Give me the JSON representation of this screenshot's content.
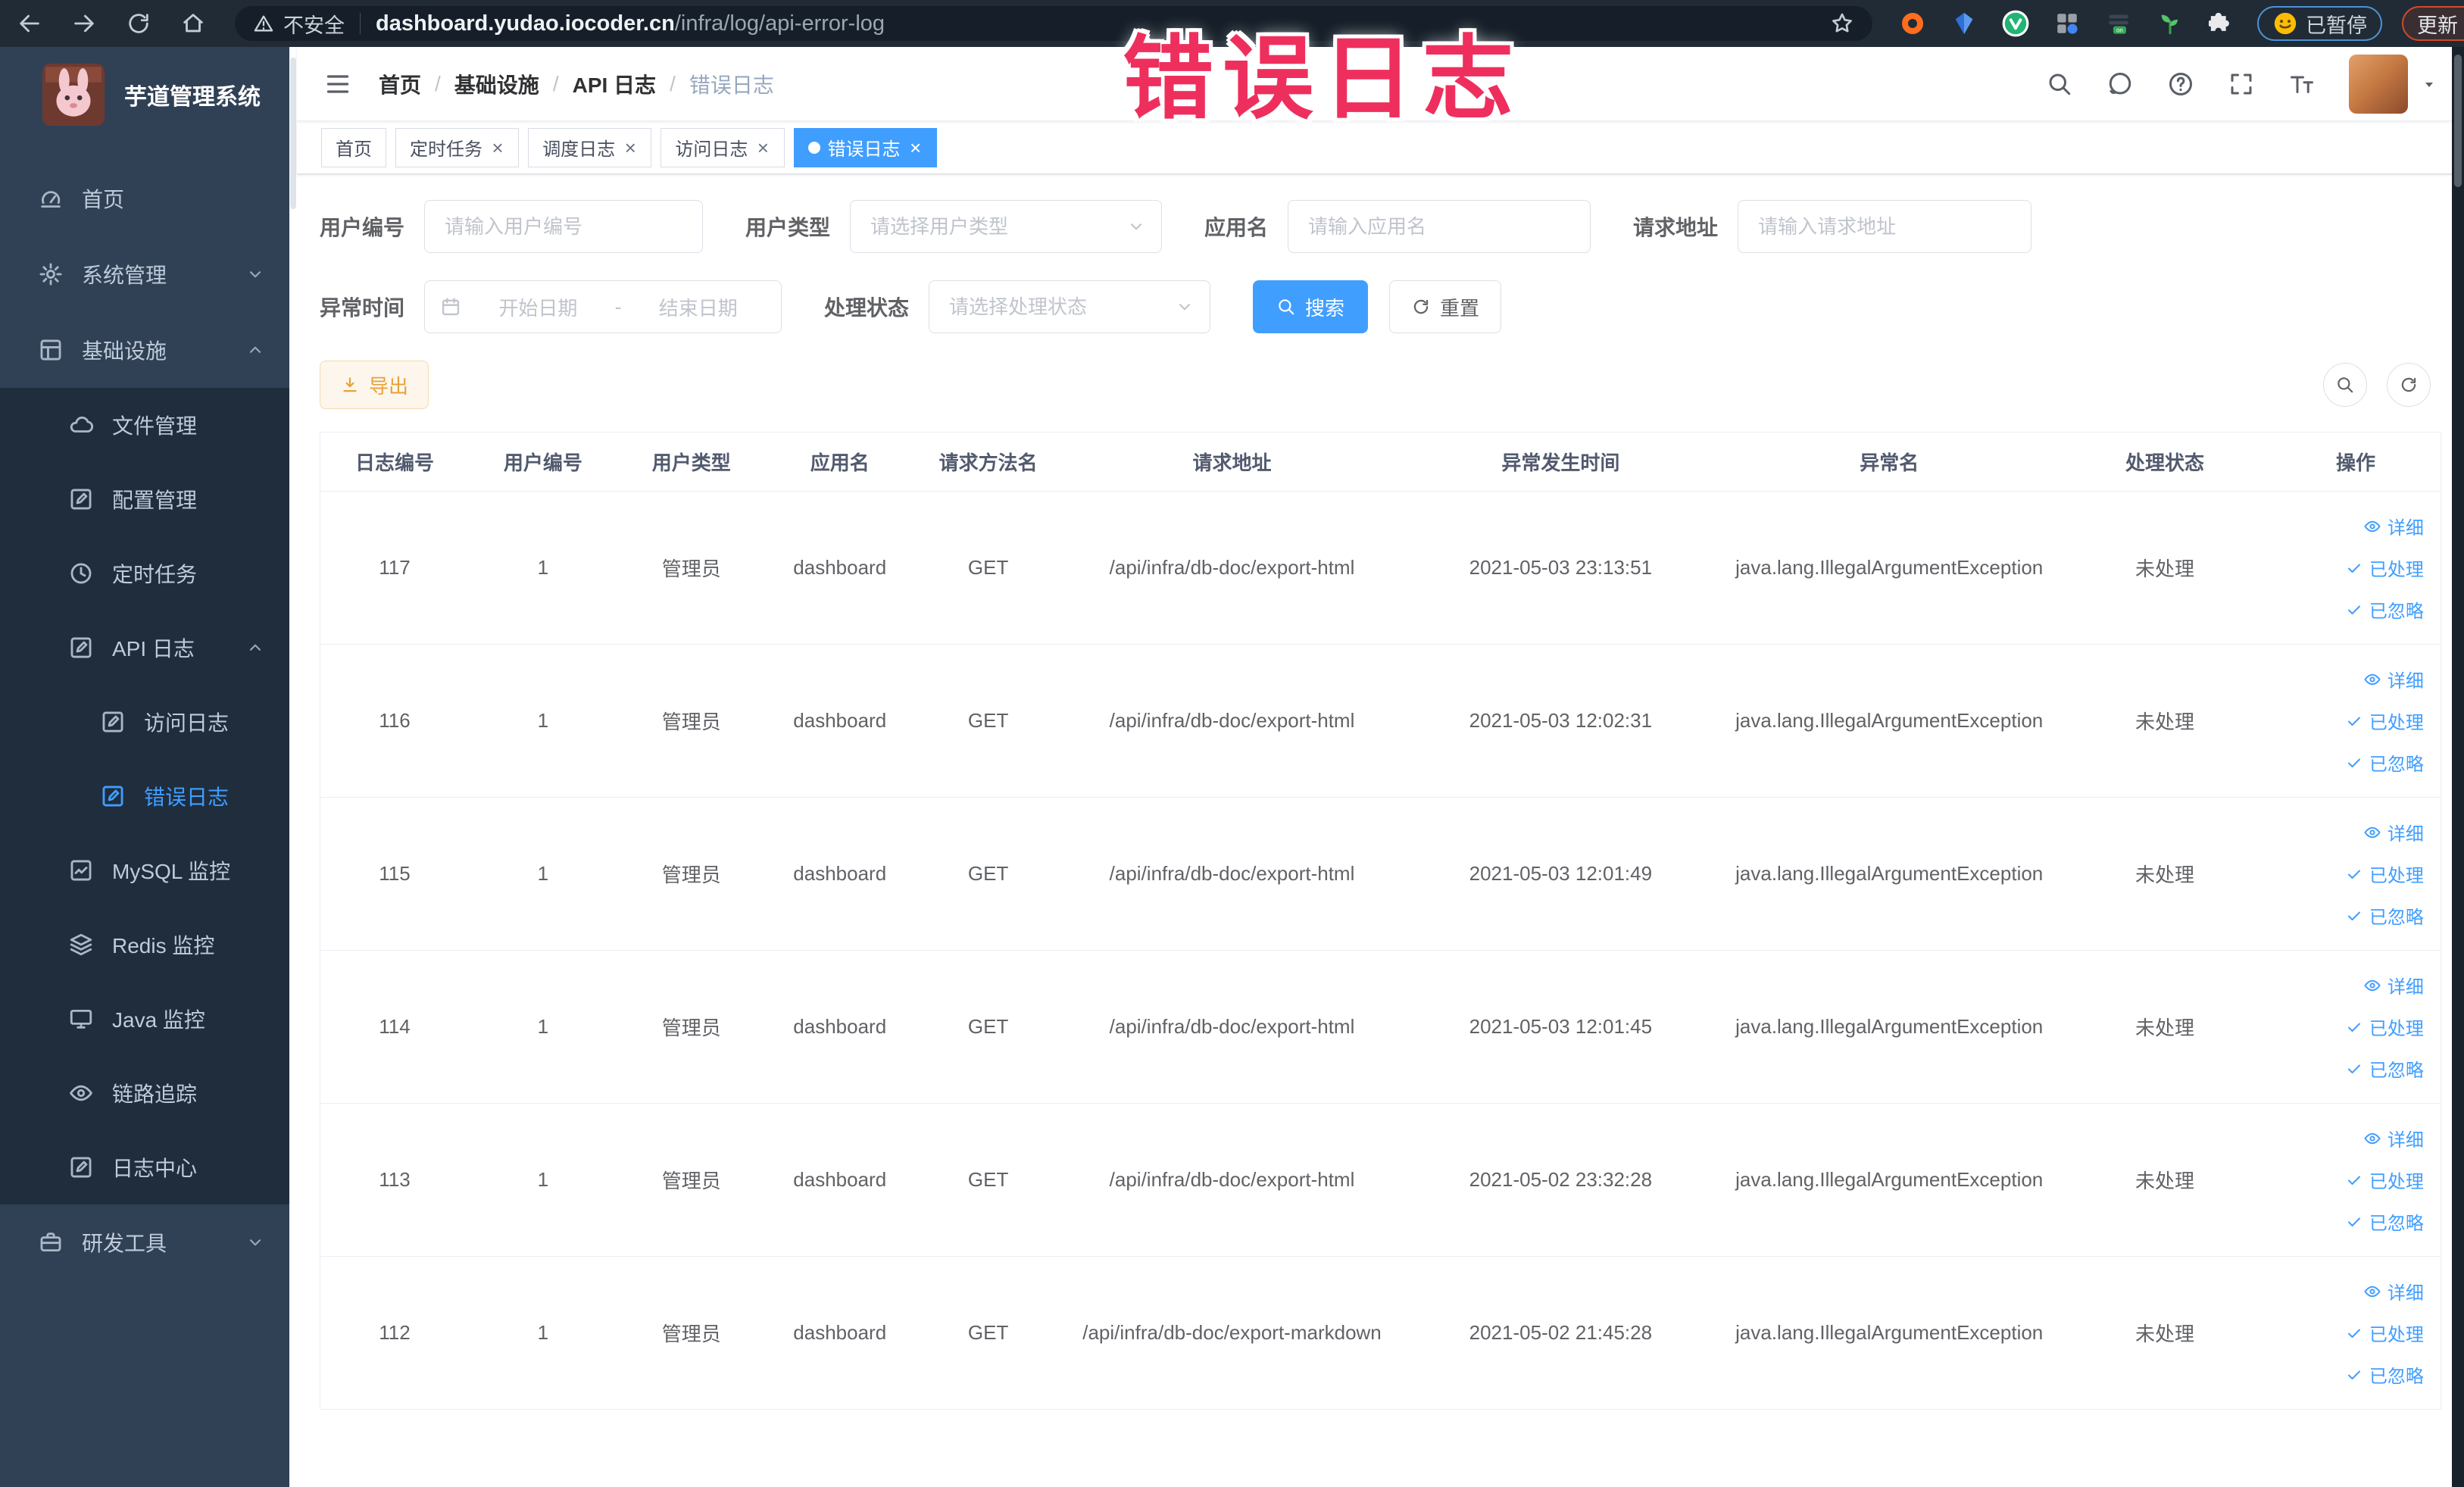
{
  "colors": {
    "primary": "#409eff",
    "sidebar_bg": "#304156",
    "submenu_bg": "#1f2d3d",
    "sidebar_text": "#bfcbd9",
    "warning_button": "#e6a23c",
    "annotation_red": "#ee2f5d",
    "browser_bar": "#212b35"
  },
  "annotation": {
    "title": "错误日志"
  },
  "browser": {
    "security_label": "不安全",
    "url_domain": "dashboard.yudao.iocoder.cn",
    "url_path": "/infra/log/api-error-log",
    "paused_badge": "已暂停",
    "update_label": "更新"
  },
  "sidebar": {
    "logo_title": "芋道管理系统",
    "menu": {
      "home": "首页",
      "system": "系统管理",
      "infra": "基础设施",
      "file": "文件管理",
      "config": "配置管理",
      "job": "定时任务",
      "api_log": "API 日志",
      "access_log": "访问日志",
      "error_log": "错误日志",
      "mysql": "MySQL 监控",
      "redis": "Redis 监控",
      "java": "Java 监控",
      "trace": "链路追踪",
      "log_center": "日志中心",
      "dev_tool": "研发工具"
    }
  },
  "navbar": {
    "breadcrumb": {
      "separator": "/",
      "items": [
        "首页",
        "基础设施",
        "API 日志",
        "错误日志"
      ]
    }
  },
  "tags": [
    {
      "label": "首页"
    },
    {
      "label": "定时任务"
    },
    {
      "label": "调度日志"
    },
    {
      "label": "访问日志"
    },
    {
      "label": "错误日志"
    }
  ],
  "filters": {
    "user_id_label": "用户编号",
    "user_id_placeholder": "请输入用户编号",
    "user_type_label": "用户类型",
    "user_type_placeholder": "请选择用户类型",
    "app_name_label": "应用名",
    "app_name_placeholder": "请输入应用名",
    "request_url_label": "请求地址",
    "request_url_placeholder": "请输入请求地址",
    "exception_time_label": "异常时间",
    "start_date_placeholder": "开始日期",
    "range_separator": "-",
    "end_date_placeholder": "结束日期",
    "process_status_label": "处理状态",
    "process_status_placeholder": "请选择处理状态",
    "search_label": "搜索",
    "reset_label": "重置"
  },
  "toolbar": {
    "export_label": "导出"
  },
  "table": {
    "columns": [
      "日志编号",
      "用户编号",
      "用户类型",
      "应用名",
      "请求方法名",
      "请求地址",
      "异常发生时间",
      "异常名",
      "处理状态",
      "操作"
    ],
    "action_labels": [
      "详细",
      "已处理",
      "已忽略"
    ],
    "rows": [
      {
        "id": "117",
        "user_id": "1",
        "user_type": "管理员",
        "app_name": "dashboard",
        "method": "GET",
        "url": "/api/infra/db-doc/export-html",
        "time": "2021-05-03 23:13:51",
        "exception": "java.lang.IllegalArgumentException",
        "status": "未处理"
      },
      {
        "id": "116",
        "user_id": "1",
        "user_type": "管理员",
        "app_name": "dashboard",
        "method": "GET",
        "url": "/api/infra/db-doc/export-html",
        "time": "2021-05-03 12:02:31",
        "exception": "java.lang.IllegalArgumentException",
        "status": "未处理"
      },
      {
        "id": "115",
        "user_id": "1",
        "user_type": "管理员",
        "app_name": "dashboard",
        "method": "GET",
        "url": "/api/infra/db-doc/export-html",
        "time": "2021-05-03 12:01:49",
        "exception": "java.lang.IllegalArgumentException",
        "status": "未处理"
      },
      {
        "id": "114",
        "user_id": "1",
        "user_type": "管理员",
        "app_name": "dashboard",
        "method": "GET",
        "url": "/api/infra/db-doc/export-html",
        "time": "2021-05-03 12:01:45",
        "exception": "java.lang.IllegalArgumentException",
        "status": "未处理"
      },
      {
        "id": "113",
        "user_id": "1",
        "user_type": "管理员",
        "app_name": "dashboard",
        "method": "GET",
        "url": "/api/infra/db-doc/export-html",
        "time": "2021-05-02 23:32:28",
        "exception": "java.lang.IllegalArgumentException",
        "status": "未处理"
      },
      {
        "id": "112",
        "user_id": "1",
        "user_type": "管理员",
        "app_name": "dashboard",
        "method": "GET",
        "url": "/api/infra/db-doc/export-markdown",
        "time": "2021-05-02 21:45:28",
        "exception": "java.lang.IllegalArgumentException",
        "status": "未处理"
      }
    ]
  }
}
